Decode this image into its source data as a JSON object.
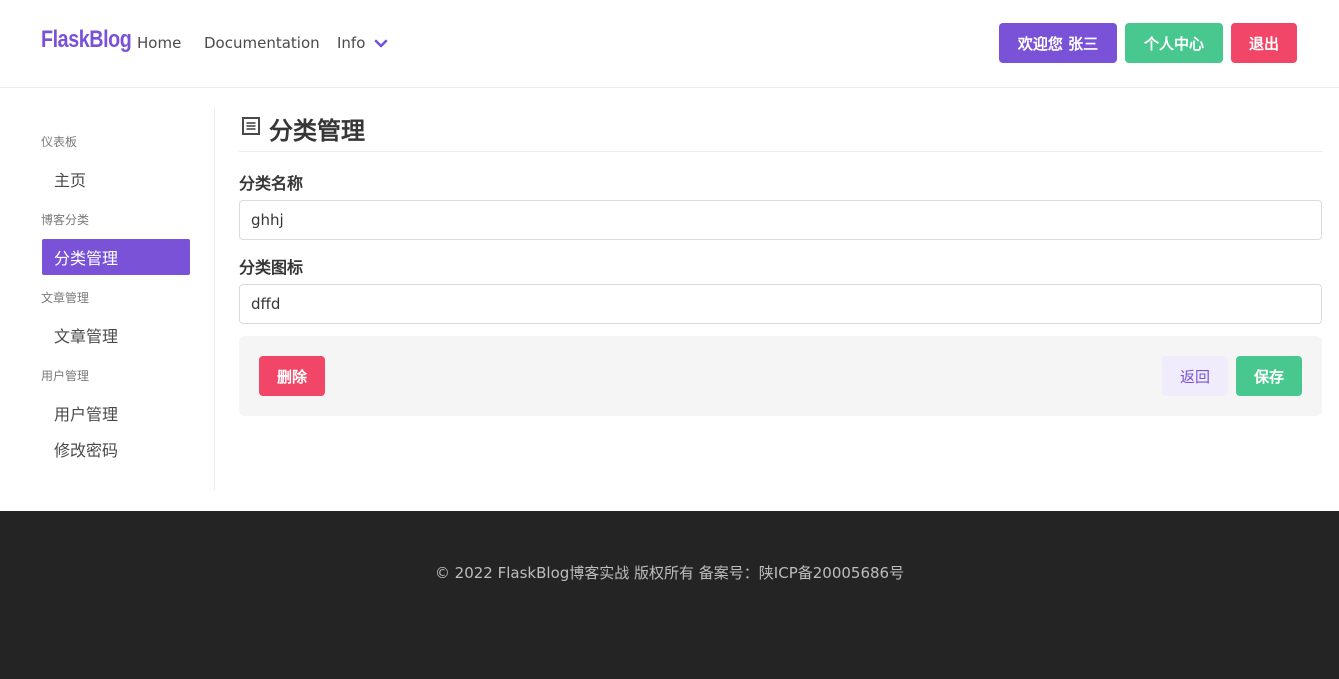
{
  "navbar": {
    "brand": "FlaskBlog",
    "links": [
      {
        "label": "Home"
      },
      {
        "label": "Documentation"
      },
      {
        "label": "Info"
      }
    ],
    "welcome_label": "欢迎您 张三",
    "profile_label": "个人中心",
    "logout_label": "退出"
  },
  "sidebar": {
    "sections": [
      {
        "label": "仪表板",
        "items": [
          {
            "label": "主页",
            "active": false
          }
        ]
      },
      {
        "label": "博客分类",
        "items": [
          {
            "label": "分类管理",
            "active": true
          }
        ]
      },
      {
        "label": "文章管理",
        "items": [
          {
            "label": "文章管理",
            "active": false
          }
        ]
      },
      {
        "label": "用户管理",
        "items": [
          {
            "label": "用户管理",
            "active": false
          },
          {
            "label": "修改密码",
            "active": false
          }
        ]
      }
    ]
  },
  "main": {
    "title": "分类管理",
    "title_icon": "list-alt-icon",
    "fields": [
      {
        "label": "分类名称",
        "value": "ghhj"
      },
      {
        "label": "分类图标",
        "value": "dffd"
      }
    ],
    "actions": {
      "delete_label": "删除",
      "back_label": "返回",
      "save_label": "保存"
    }
  },
  "footer": {
    "text": "© 2022 FlaskBlog博客实战 版权所有 备案号：陕ICP备20005686号"
  },
  "colors": {
    "primary": "#7952d8",
    "success": "#48c78e",
    "danger": "#f14668",
    "footer_bg": "#242424"
  }
}
